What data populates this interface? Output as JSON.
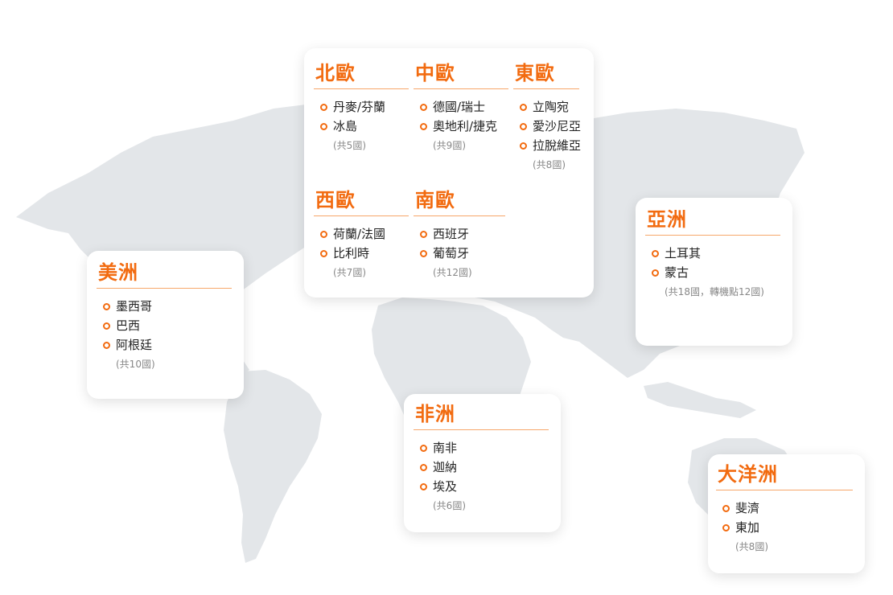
{
  "theme": {
    "accent": "#f26b10",
    "map_fill": "#e3e6e9",
    "card_bg": "#ffffff"
  },
  "regions": {
    "north_europe": {
      "title": "北歐",
      "countries": [
        "丹麥/芬蘭",
        "冰島"
      ],
      "count": "(共5國)"
    },
    "central_europe": {
      "title": "中歐",
      "countries": [
        "德國/瑞士",
        "奧地利/捷克"
      ],
      "count": "(共9國)"
    },
    "east_europe": {
      "title": "東歐",
      "countries": [
        "立陶宛",
        "愛沙尼亞",
        "拉脫維亞"
      ],
      "count": "(共8國)"
    },
    "west_europe": {
      "title": "西歐",
      "countries": [
        "荷蘭/法國",
        "比利時"
      ],
      "count": "(共7國)"
    },
    "south_europe": {
      "title": "南歐",
      "countries": [
        "西班牙",
        "葡萄牙"
      ],
      "count": "(共12國)"
    },
    "asia": {
      "title": "亞洲",
      "countries": [
        "土耳其",
        "蒙古"
      ],
      "count": "(共18國，轉機點12國)"
    },
    "americas": {
      "title": "美洲",
      "countries": [
        "墨西哥",
        "巴西",
        "阿根廷"
      ],
      "count": "(共10國)"
    },
    "africa": {
      "title": "非洲",
      "countries": [
        "南非",
        "迦納",
        "埃及"
      ],
      "count": "(共6國)"
    },
    "oceania": {
      "title": "大洋洲",
      "countries": [
        "斐濟",
        "東加"
      ],
      "count": "(共8國)"
    }
  }
}
